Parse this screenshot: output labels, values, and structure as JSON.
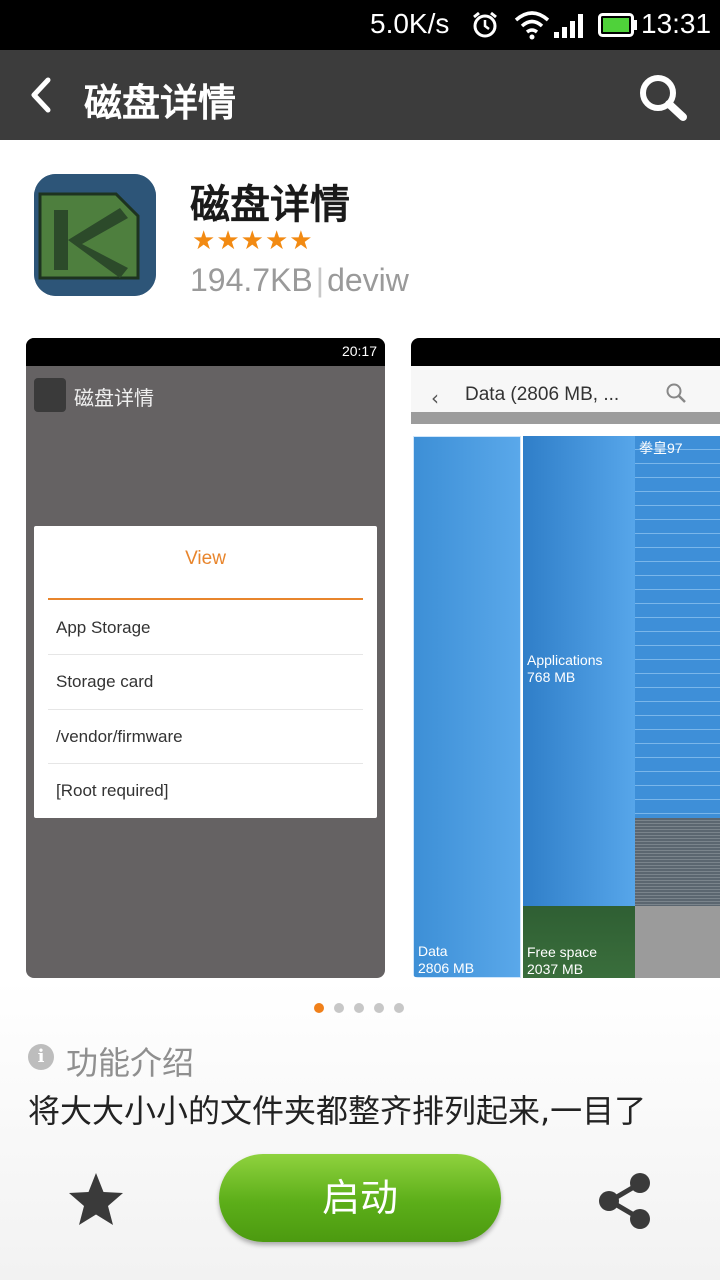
{
  "status_bar": {
    "net_speed": "5.0K/s",
    "time": "13:31",
    "icons": [
      "alarm-icon",
      "wifi-icon",
      "signal-icon",
      "battery-icon"
    ]
  },
  "action_bar": {
    "title": "磁盘详情",
    "icons": [
      "back-arrow-icon",
      "search-icon"
    ]
  },
  "app": {
    "name": "磁盘详情",
    "rating_stars": 5,
    "rating_max": 5,
    "size": "194.7KB",
    "separator": "|",
    "developer": "deviw"
  },
  "screenshots": {
    "first": {
      "clock": "20:17",
      "app_title": "磁盘详情",
      "dialog_title": "View",
      "dialog_items": [
        "App Storage",
        "Storage card",
        "/vendor/firmware",
        "[Root required]"
      ]
    },
    "second": {
      "bar_title": "Data (2806 MB, ...",
      "tiles": {
        "data": {
          "label": "Data",
          "size": "2806 MB"
        },
        "applications": {
          "label": "Applications",
          "size": "768 MB"
        },
        "free": {
          "label": "Free space",
          "size": "2037 MB"
        },
        "small": {
          "label": "拳皇97"
        }
      }
    },
    "page_count": 5,
    "active_page": 1
  },
  "description": {
    "title": "功能介绍",
    "text": "将大大小小的文件夹都整齐排列起来,一目了"
  },
  "bottom_bar": {
    "launch_label": "启动",
    "icons": [
      "star-icon",
      "share-icon"
    ]
  },
  "colors": {
    "accent_orange": "#f0801a",
    "launch_green": "#5cae19",
    "action_bar": "#3c3c3c"
  }
}
